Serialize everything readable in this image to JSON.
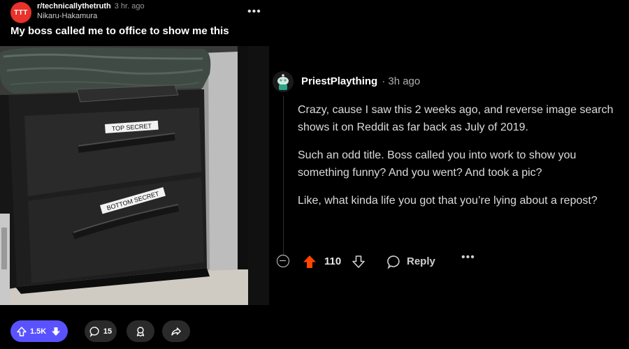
{
  "post": {
    "subreddit_avatar_text": "TTT",
    "subreddit": "r/technicallythetruth",
    "age": "3 hr. ago",
    "author": "Nikaru-Hakamura",
    "overflow": "•••",
    "title": "My boss called me to office to show me this",
    "image_labels": {
      "top_drawer": "TOP SECRET",
      "bottom_drawer": "BOTTOM SECRET"
    },
    "actions": {
      "vote_count": "1.5K",
      "comment_count": "15"
    }
  },
  "comment": {
    "username": "PriestPlaything",
    "age": "· 3h ago",
    "paragraphs": [
      "Crazy, cause I saw this 2 weeks ago, and reverse image search shows it on Reddit as far back as July of 2019.",
      "Such an odd title. Boss called you into work to show you something funny? And you went? And took a pic?",
      "Like, what kinda life you got that you’re lying about a repost?"
    ],
    "score": "110",
    "reply_label": "Reply",
    "overflow": "•••"
  },
  "colors": {
    "background": "#000000",
    "subreddit_avatar": "#e8322b",
    "upvote_pill": "#5a52ff",
    "comment_upvote": "#ff4500"
  },
  "icons": [
    "upvote-icon",
    "downvote-icon",
    "comment-icon",
    "award-icon",
    "share-icon",
    "collapse-icon",
    "reply-icon",
    "overflow-icon"
  ]
}
